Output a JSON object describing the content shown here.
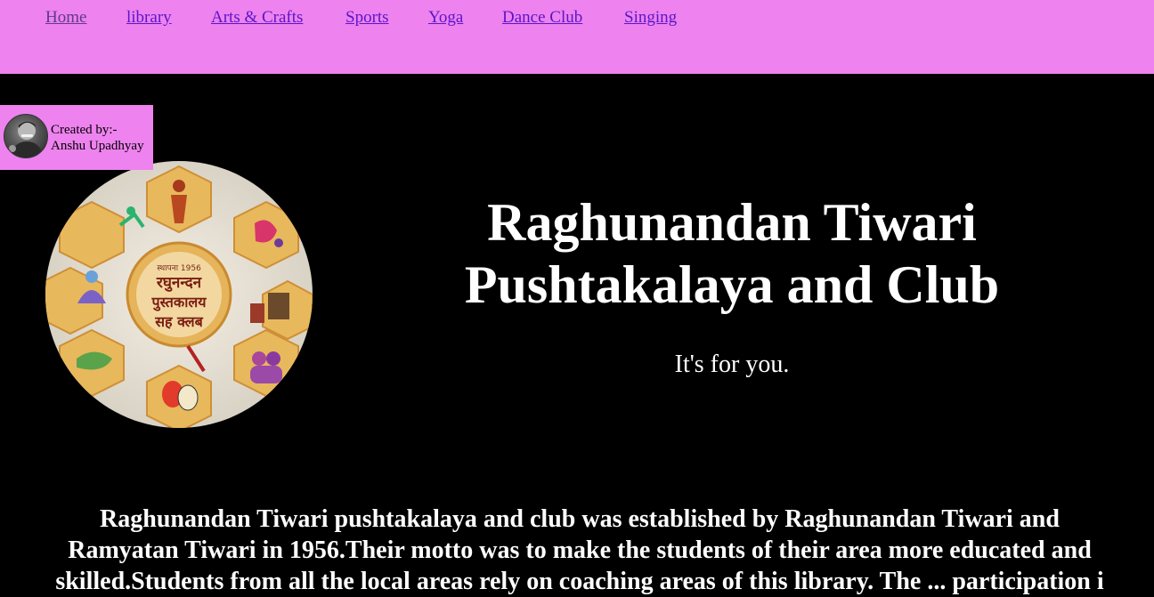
{
  "nav": {
    "links": [
      "Home",
      "library",
      "Arts & Crafts",
      "Sports",
      "Yoga",
      "Dance Club",
      "Singing"
    ]
  },
  "creator": {
    "line1": "Created by:-",
    "line2": "Anshu Upadhyay"
  },
  "logo": {
    "text_line1": "रघुनन्दन",
    "text_line2": "पुस्तकालय",
    "text_line3": "सह क्लब",
    "year": "स्थापना 1956"
  },
  "hero": {
    "title_line1": "Raghunandan Tiwari",
    "title_line2": "Pushtakalaya and Club",
    "subtitle": "It's for you."
  },
  "about": {
    "line1": "Raghunandan Tiwari pushtakalaya and club was established by Raghunandan Tiwari and",
    "line2": "Ramyatan Tiwari in 1956.Their motto was to make the students of their area more educated and",
    "line3": "skilled.Students from all the local areas rely on coaching areas of this library. The ... participation i"
  },
  "colors": {
    "nav_bg": "#ee82ee",
    "page_bg": "#000000",
    "link": "#5a16c9",
    "visited_link": "#5e3a8a"
  }
}
